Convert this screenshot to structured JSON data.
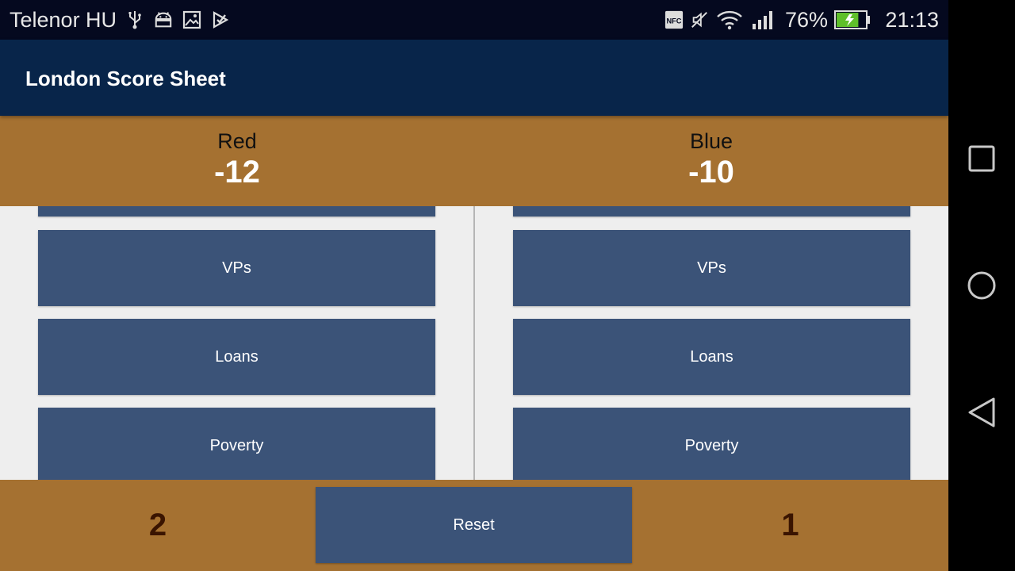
{
  "status_bar": {
    "carrier": "Telenor HU",
    "icons_left": [
      "usb-icon",
      "android-icon",
      "image-icon",
      "task-icon"
    ],
    "icons_right": [
      "nfc-icon",
      "mute-icon",
      "wifi-icon",
      "signal-icon"
    ],
    "nfc_label": "NFC",
    "battery_percent": "76%",
    "battery_level": 0.76,
    "battery_charging": true,
    "time": "21:13"
  },
  "app_bar": {
    "title": "London Score Sheet"
  },
  "teams": [
    {
      "name": "Red",
      "score": "-12",
      "categories": [
        "VPs",
        "Loans",
        "Poverty"
      ]
    },
    {
      "name": "Blue",
      "score": "-10",
      "categories": [
        "VPs",
        "Loans",
        "Poverty"
      ]
    }
  ],
  "bottom_bar": {
    "left_count": "2",
    "reset_label": "Reset",
    "right_count": "1"
  },
  "nav_bar": {
    "buttons": [
      "recents-square-icon",
      "home-circle-icon",
      "back-triangle-icon"
    ]
  },
  "colors": {
    "status_bar": "#05091f",
    "app_bar": "#08254a",
    "accent_brown": "#a57131",
    "button_blue": "#3b5378",
    "background": "#eeeeee",
    "count_text": "#3a1400"
  }
}
